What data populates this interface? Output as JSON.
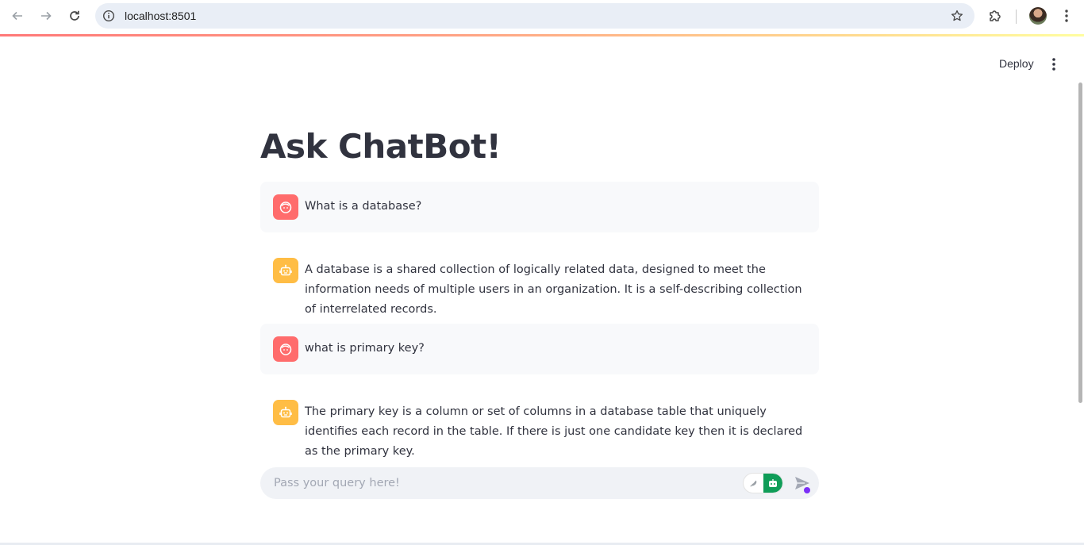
{
  "browser": {
    "url": "localhost:8501"
  },
  "header": {
    "deploy_label": "Deploy"
  },
  "main": {
    "title": "Ask ChatBot!",
    "messages": [
      {
        "role": "user",
        "text": "What is a database?"
      },
      {
        "role": "assistant",
        "text": "A database is a shared collection of logically related data, designed to meet the information needs of multiple users in an organization. It is a self-describing collection of interrelated records."
      },
      {
        "role": "user",
        "text": "what is primary key?"
      },
      {
        "role": "assistant",
        "text": "The primary key is a column or set of columns in a database table that uniquely identifies each record in the table. If there is just one candidate key then it is declared as the primary key."
      }
    ]
  },
  "chat_input": {
    "placeholder": "Pass your query here!",
    "value": ""
  },
  "colors": {
    "user_avatar": "#ff6c6c",
    "assistant_avatar": "#ffbd45",
    "toggle_active": "#0f9d58",
    "text": "#31333f"
  }
}
